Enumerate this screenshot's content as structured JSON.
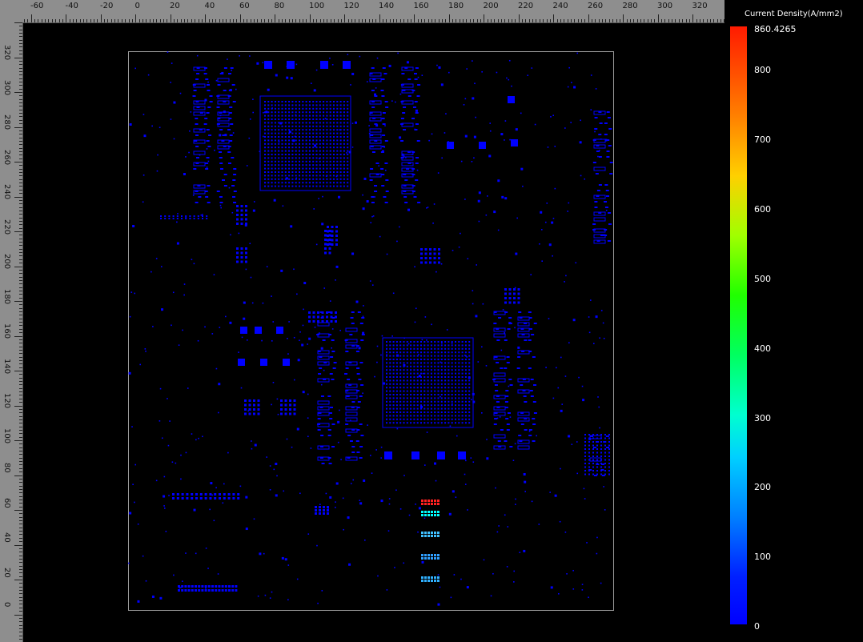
{
  "ruler": {
    "horizontal_labels": [
      "-60",
      "-40",
      "-20",
      "0",
      "20",
      "40",
      "60",
      "80",
      "100",
      "120",
      "140",
      "160",
      "180",
      "200",
      "220",
      "240",
      "260",
      "280",
      "300",
      "320"
    ],
    "vertical_labels": [
      "320",
      "300",
      "280",
      "260",
      "240",
      "220",
      "200",
      "180",
      "160",
      "140",
      "120",
      "100",
      "80",
      "60",
      "40",
      "20",
      "0"
    ]
  },
  "legend": {
    "title": "Current Density(A/mm2)",
    "max_label": "860.4265",
    "ticks": [
      "800",
      "700",
      "600",
      "500",
      "400",
      "300",
      "200",
      "100",
      "0"
    ],
    "max_value": 860.4265,
    "min_value": 0
  },
  "colors": {
    "background": "#000000",
    "ruler": "#8e8e8e",
    "board_outline": "#9a9a9a",
    "pad_low": "#0000ff",
    "pad_mid": "#00ffff",
    "pad_high": "#ff2020"
  },
  "hotspots": [
    {
      "name": "connector-pins-high",
      "value": 860
    },
    {
      "name": "connector-pins-mid",
      "value": 200
    },
    {
      "name": "connector-pins-low",
      "value": 100
    }
  ]
}
